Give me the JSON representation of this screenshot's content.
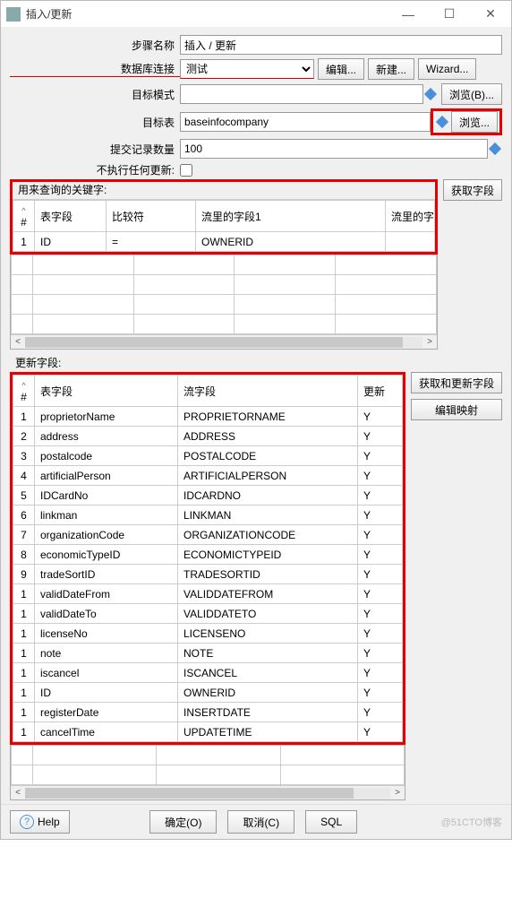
{
  "window": {
    "title": "插入/更新",
    "minimize": "—",
    "maximize": "☐",
    "close": "✕"
  },
  "form": {
    "step_name_label": "步骤名称",
    "step_name_value": "插入 / 更新",
    "db_conn_label": "数据库连接",
    "db_conn_value": "测试",
    "edit_btn": "编辑...",
    "new_btn": "新建...",
    "wizard_btn": "Wizard...",
    "target_schema_label": "目标模式",
    "target_schema_value": "",
    "browse_b_btn": "浏览(B)...",
    "target_table_label": "目标表",
    "target_table_value": "baseinfocompany",
    "browse_btn": "浏览...",
    "commit_label": "提交记录数量",
    "commit_value": "100",
    "no_update_label": "不执行任何更新:"
  },
  "keys": {
    "section_label": "用来查询的关键字:",
    "get_fields_btn": "获取字段",
    "headers": {
      "num": "#",
      "field": "表字段",
      "compare": "比较符",
      "stream1": "流里的字段1",
      "stream2": "流里的字"
    },
    "rows": [
      {
        "num": "1",
        "field": "ID",
        "compare": "=",
        "stream1": "OWNERID",
        "stream2": ""
      }
    ]
  },
  "update": {
    "section_label": "更新字段:",
    "get_update_btn": "获取和更新字段",
    "edit_map_btn": "编辑映射",
    "headers": {
      "num": "#",
      "field": "表字段",
      "stream": "流字段",
      "upd": "更新"
    },
    "rows": [
      {
        "num": "1",
        "field": "proprietorName",
        "stream": "PROPRIETORNAME",
        "upd": "Y"
      },
      {
        "num": "2",
        "field": "address",
        "stream": "ADDRESS",
        "upd": "Y"
      },
      {
        "num": "3",
        "field": "postalcode",
        "stream": "POSTALCODE",
        "upd": "Y"
      },
      {
        "num": "4",
        "field": "artificialPerson",
        "stream": "ARTIFICIALPERSON",
        "upd": "Y"
      },
      {
        "num": "5",
        "field": "IDCardNo",
        "stream": "IDCARDNO",
        "upd": "Y"
      },
      {
        "num": "6",
        "field": "linkman",
        "stream": "LINKMAN",
        "upd": "Y"
      },
      {
        "num": "7",
        "field": "organizationCode",
        "stream": "ORGANIZATIONCODE",
        "upd": "Y"
      },
      {
        "num": "8",
        "field": "economicTypeID",
        "stream": "ECONOMICTYPEID",
        "upd": "Y"
      },
      {
        "num": "9",
        "field": "tradeSortID",
        "stream": "TRADESORTID",
        "upd": "Y"
      },
      {
        "num": "1",
        "field": "validDateFrom",
        "stream": "VALIDDATEFROM",
        "upd": "Y"
      },
      {
        "num": "1",
        "field": "validDateTo",
        "stream": "VALIDDATETO",
        "upd": "Y"
      },
      {
        "num": "1",
        "field": "licenseNo",
        "stream": "LICENSENO",
        "upd": "Y"
      },
      {
        "num": "1",
        "field": "note",
        "stream": "NOTE",
        "upd": "Y"
      },
      {
        "num": "1",
        "field": "iscancel",
        "stream": "ISCANCEL",
        "upd": "Y"
      },
      {
        "num": "1",
        "field": "ID",
        "stream": "OWNERID",
        "upd": "Y"
      },
      {
        "num": "1",
        "field": "registerDate",
        "stream": "INSERTDATE",
        "upd": "Y"
      },
      {
        "num": "1",
        "field": "cancelTime",
        "stream": "UPDATETIME",
        "upd": "Y"
      }
    ]
  },
  "footer": {
    "help": "Help",
    "ok": "确定(O)",
    "cancel": "取消(C)",
    "sql": "SQL",
    "watermark": "@51CTO博客"
  }
}
